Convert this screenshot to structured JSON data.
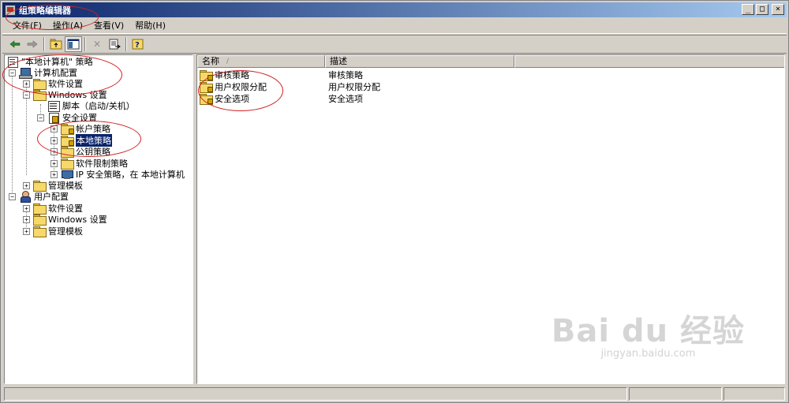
{
  "window": {
    "title": "组策略编辑器",
    "controls": [
      "_",
      "□",
      "×"
    ]
  },
  "menu": [
    {
      "label": "文件(F)"
    },
    {
      "label": "操作(A)"
    },
    {
      "label": "查看(V)"
    },
    {
      "label": "帮助(H)"
    }
  ],
  "toolbar": {
    "back_icon": "←",
    "forward_icon": "→",
    "up_icon": "folder-up",
    "show_tree_icon": "show-hide-tree",
    "delete_icon": "✕",
    "export_icon": "export-list",
    "help_icon": "help"
  },
  "tree": {
    "root": "\"本地计算机\" 策略",
    "computer_config": "计算机配置",
    "software_settings": "软件设置",
    "windows_settings": "Windows 设置",
    "scripts": "脚本（启动/关机）",
    "security_settings": "安全设置",
    "account_policies": "帐户策略",
    "local_policies": "本地策略",
    "public_key_policies": "公钥策略",
    "software_restriction": "软件限制策略",
    "ip_security": "IP 安全策略，在 本地计算机",
    "admin_templates": "管理模板",
    "user_config": "用户配置",
    "user_software_settings": "软件设置",
    "user_windows_settings": "Windows 设置",
    "user_admin_templates": "管理模板"
  },
  "list": {
    "columns": [
      "名称",
      "描述"
    ],
    "sort_indicator": "/",
    "rows": [
      {
        "name": "审核策略",
        "desc": "审核策略"
      },
      {
        "name": "用户权限分配",
        "desc": "用户权限分配"
      },
      {
        "name": "安全选项",
        "desc": "安全选项"
      }
    ]
  },
  "watermark": {
    "logo": "Bai du 经验",
    "url": "jingyan.baidu.com"
  },
  "colors": {
    "title_gradient_start": "#0a246a",
    "title_gradient_end": "#a6caf0",
    "selection": "#0a246a",
    "annotation": "#d02020"
  }
}
